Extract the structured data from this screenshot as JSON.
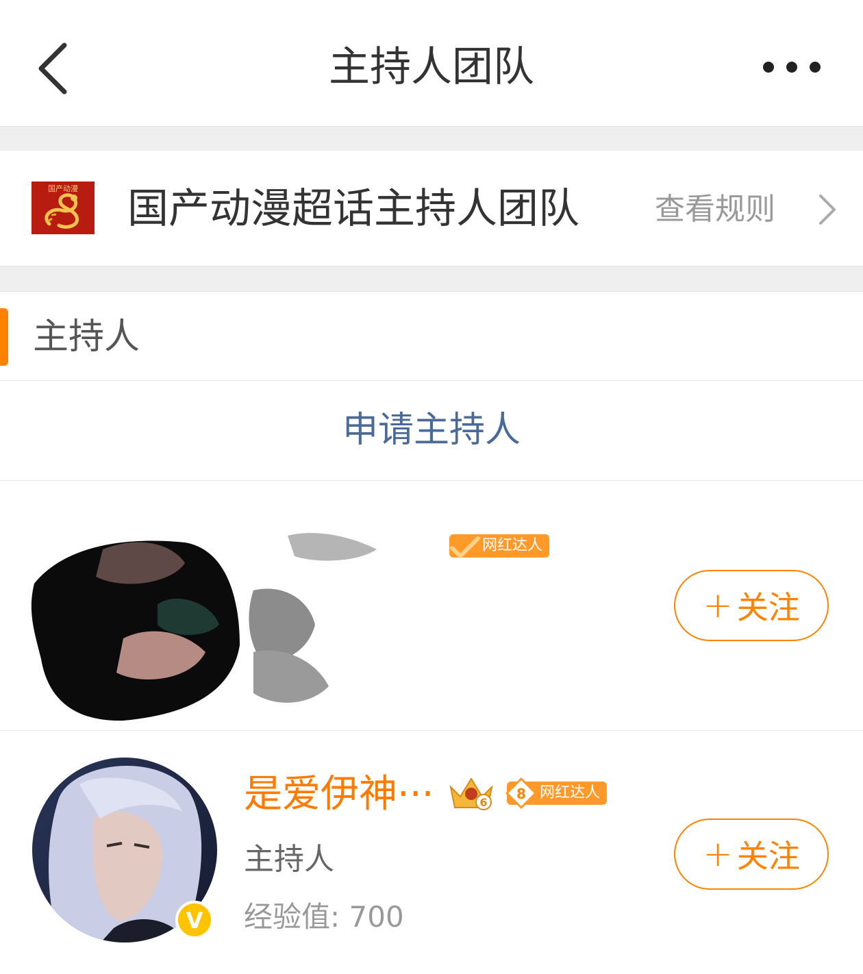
{
  "header": {
    "title": "主持人团队",
    "back_icon": "chevron-left-icon",
    "more_icon": "more-dots-icon"
  },
  "team": {
    "logo_text": "国产动漫",
    "name": "国产动漫超话主持人团队",
    "rules_label": "查看规则",
    "rules_icon": "chevron-right-icon"
  },
  "section": {
    "title": "主持人",
    "accent_color": "#ff8200"
  },
  "apply": {
    "label": "申请主持人"
  },
  "members": [
    {
      "name": "",
      "role": "",
      "badge": "网红达人",
      "follow_label": "关注",
      "avatar": "redacted"
    },
    {
      "name": "是爱伊神···",
      "role": "主持人",
      "exp": "经验值: 700",
      "badge_level": "8",
      "badge": "网红达人",
      "crown_level": "6",
      "follow_label": "关注",
      "verified": "V"
    }
  ],
  "colors": {
    "accent": "#ff8200",
    "link": "#4a6b9a"
  }
}
